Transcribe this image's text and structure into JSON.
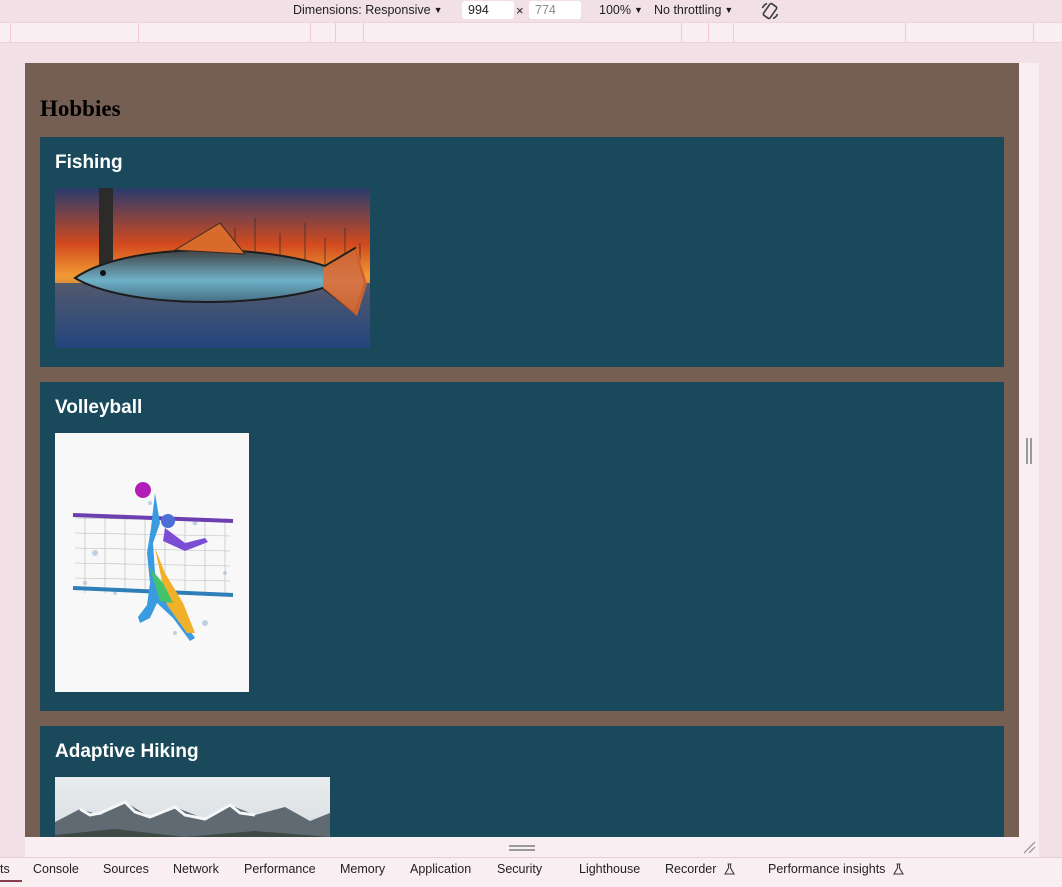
{
  "toolbar": {
    "dimensions_label": "Dimensions: Responsive",
    "width_value": "994",
    "height_placeholder": "774",
    "times_symbol": "×",
    "zoom_label": "100%",
    "throttling_label": "No throttling",
    "rotate_icon": "rotate-device-icon"
  },
  "page": {
    "heading": "Hobbies",
    "cards": [
      {
        "title": "Fishing"
      },
      {
        "title": "Volleyball"
      },
      {
        "title": "Adaptive Hiking"
      }
    ]
  },
  "devtools": {
    "tabs": [
      {
        "label": "ts"
      },
      {
        "label": "Console"
      },
      {
        "label": "Sources"
      },
      {
        "label": "Network"
      },
      {
        "label": "Performance"
      },
      {
        "label": "Memory"
      },
      {
        "label": "Application"
      },
      {
        "label": "Security"
      },
      {
        "label": "Lighthouse"
      },
      {
        "label": "Recorder"
      },
      {
        "label": "Performance insights"
      }
    ],
    "accent_color": "#8b3b4f"
  },
  "colors": {
    "page_background": "#745f52",
    "card_background": "#19495a",
    "chrome_background": "#f1e1e6"
  }
}
